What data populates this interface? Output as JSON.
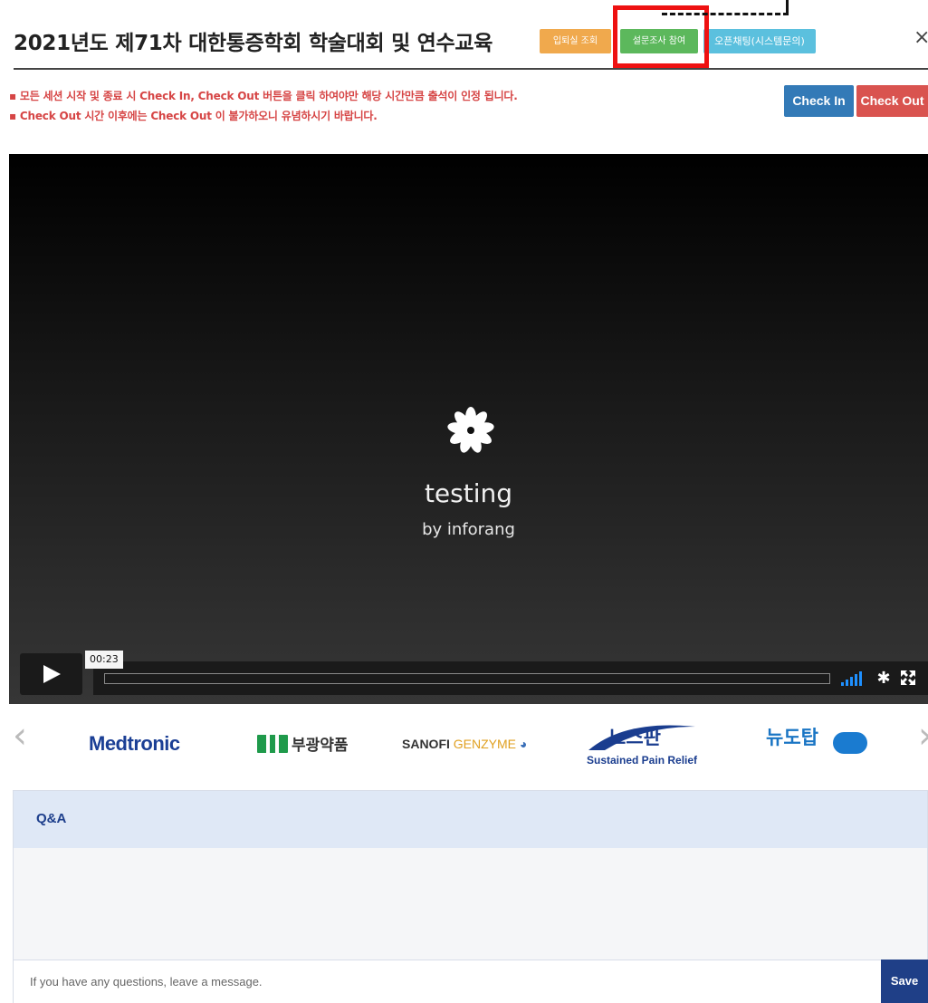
{
  "header": {
    "title": "2021년도 제71차 대한통증학회 학술대회 및 연수교육",
    "buttons": {
      "entry_lookup": "입퇴실 조회",
      "survey": "설문조사 참여",
      "open_chat": "오픈채팅(시스템문의)"
    },
    "close_symbol": "×"
  },
  "notices": [
    "▪ 모든 세션 시작 및 종료 시 Check In, Check Out 버튼을 클릭 하여야만 해당 시간만큼 출석이 인정 됩니다.",
    "▪ Check Out 시간 이후에는 Check Out 이 불가하오니 유념하시기 바랍니다."
  ],
  "attendance": {
    "check_in": "Check In",
    "check_out": "Check Out"
  },
  "video": {
    "title": "testing",
    "subtitle": "by inforang",
    "time_tooltip": "00:23",
    "settings_symbol": "✱",
    "volume_level": 1.0
  },
  "sponsors": {
    "medtronic": "Medtronic",
    "bukwang": "부광약품",
    "sanofi": "SANOFI",
    "genzyme": "GENZYME",
    "nospan_ko": "노스판",
    "nospan_en": "Sustained Pain Relief",
    "nudotap": "뉴도탑",
    "prev_symbol": "‹",
    "next_symbol": "›"
  },
  "qa": {
    "title": "Q&A",
    "input_placeholder": "If you have any questions, leave a message.",
    "save": "Save"
  },
  "colors": {
    "accent_blue": "#337ab7",
    "danger_red": "#d9534f",
    "orange": "#f0a94d",
    "green": "#5cb85c",
    "teal": "#5bc0de",
    "qa_navy": "#1f3f87",
    "annotation_red": "#ee1111"
  }
}
